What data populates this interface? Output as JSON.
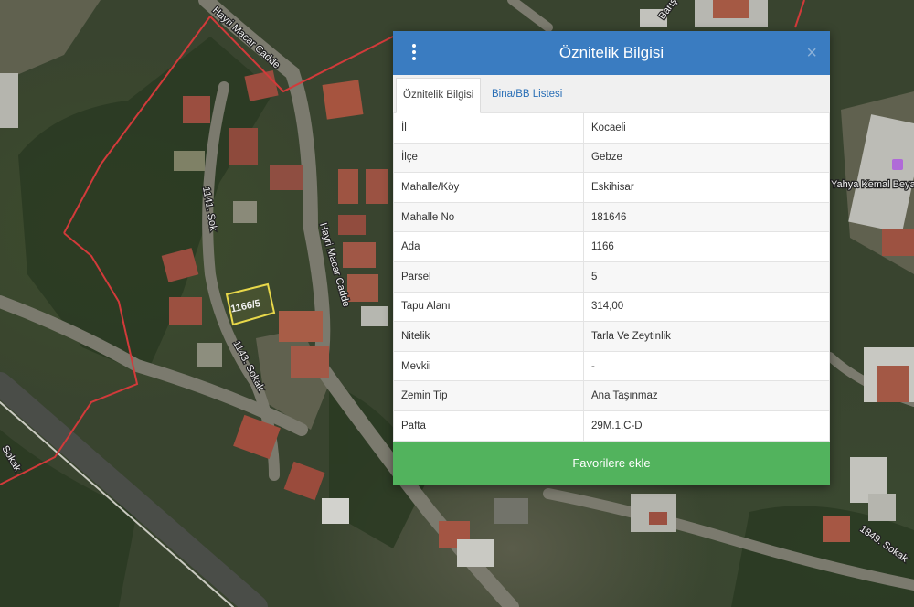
{
  "dialog": {
    "title": "Öznitelik Bilgisi",
    "close_symbol": "×",
    "menu_icon": "vertical-ellipsis-icon",
    "close_icon": "close-icon",
    "tabs": [
      {
        "label": "Öznitelik Bilgisi",
        "active": true
      },
      {
        "label": "Bina/BB Listesi",
        "active": false
      }
    ],
    "rows": [
      {
        "key": "İl",
        "value": "Kocaeli"
      },
      {
        "key": "İlçe",
        "value": "Gebze"
      },
      {
        "key": "Mahalle/Köy",
        "value": "Eskihisar"
      },
      {
        "key": "Mahalle No",
        "value": "181646"
      },
      {
        "key": "Ada",
        "value": "1166"
      },
      {
        "key": "Parsel",
        "value": "5"
      },
      {
        "key": "Tapu Alanı",
        "value": "314,00"
      },
      {
        "key": "Nitelik",
        "value": "Tarla Ve Zeytinlik"
      },
      {
        "key": "Mevkii",
        "value": "-"
      },
      {
        "key": "Zemin Tip",
        "value": "Ana Taşınmaz"
      },
      {
        "key": "Pafta",
        "value": "29M.1.C-D"
      }
    ],
    "favorite_button": "Favorilere ekle"
  },
  "map": {
    "parcel_label": "1166/5",
    "street_labels": {
      "hayri_macar_top": "Hayri Macar Cadde",
      "hayri_macar_mid": "Hayri Macar Cadde",
      "sokak_1141": "1141. Sok",
      "sokak_1143": "1143. Sokak",
      "sokak_left": "Sokak",
      "sokak_1849": "1849. Sokak",
      "yahya_kemal": "Yahya Kemal Beya",
      "top_right": "Barış"
    },
    "colors": {
      "boundary": "#d23a3a",
      "parcel_outline": "#e8d84a",
      "header": "#3a7cc1",
      "button": "#52b35d"
    }
  }
}
